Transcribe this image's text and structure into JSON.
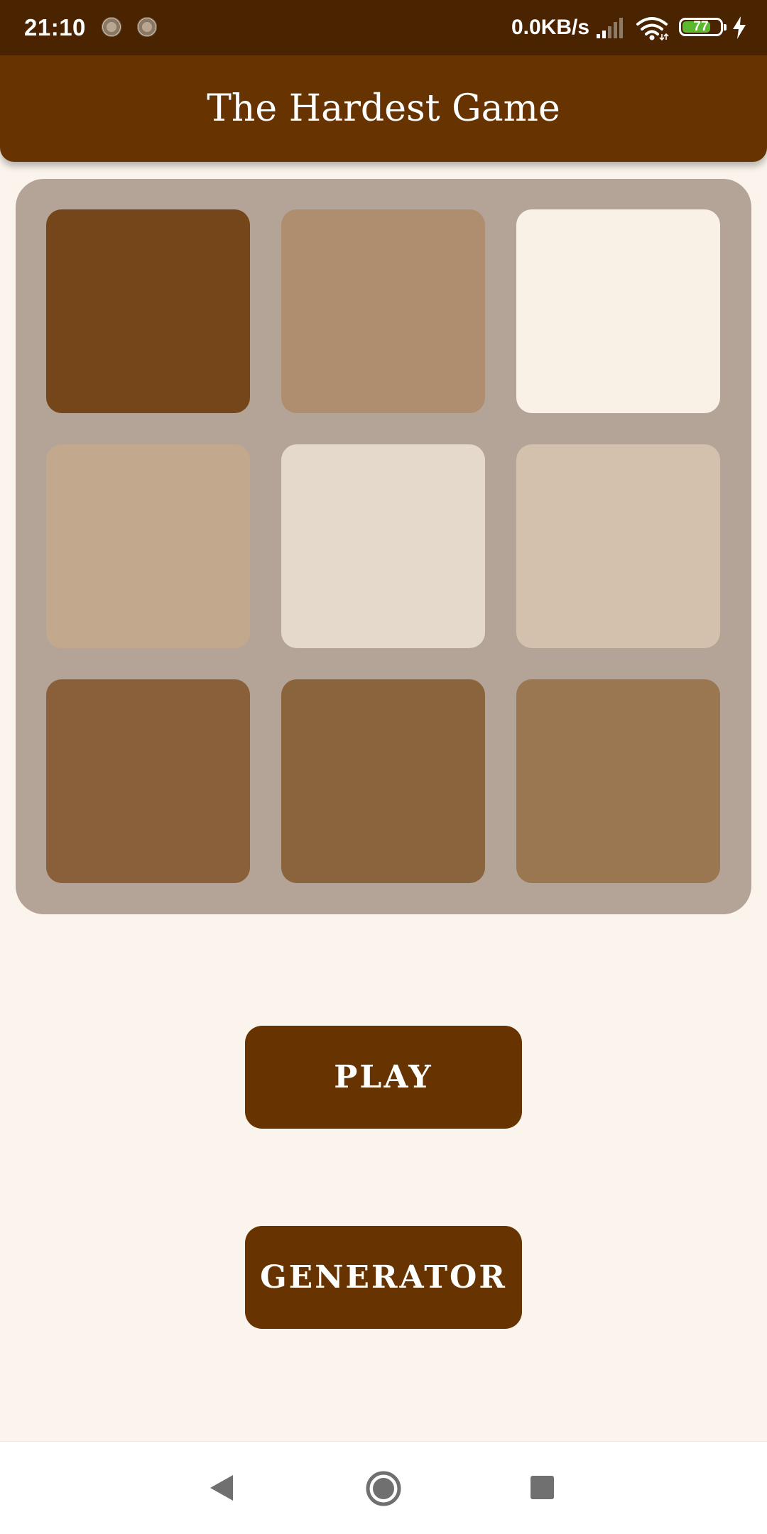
{
  "status_bar": {
    "time": "21:10",
    "network_speed": "0.0KB/s",
    "battery_level": "77",
    "icons": [
      "notification-icon",
      "notification-icon",
      "signal-icon",
      "wifi-icon",
      "battery-icon",
      "charging-icon"
    ]
  },
  "app_bar": {
    "title": "The Hardest Game"
  },
  "board": {
    "background_color": "#b4a497",
    "tiles": [
      {
        "color": "#75461a"
      },
      {
        "color": "#ae8e6e"
      },
      {
        "color": "#f9f0e6"
      },
      {
        "color": "#c2a98d"
      },
      {
        "color": "#e4d9ca"
      },
      {
        "color": "#d3c1ae"
      },
      {
        "color": "#8a603a"
      },
      {
        "color": "#8a643c"
      },
      {
        "color": "#9b7751"
      }
    ]
  },
  "buttons": {
    "play_label": "PLAY",
    "generator_label": "GENERATOR"
  },
  "colors": {
    "status_bar": "#4a2300",
    "primary": "#673300",
    "background": "#faf4ec",
    "battery_fill": "#5cb82e"
  },
  "nav_bar": {
    "icons": [
      "back-icon",
      "home-icon",
      "recents-icon"
    ]
  }
}
